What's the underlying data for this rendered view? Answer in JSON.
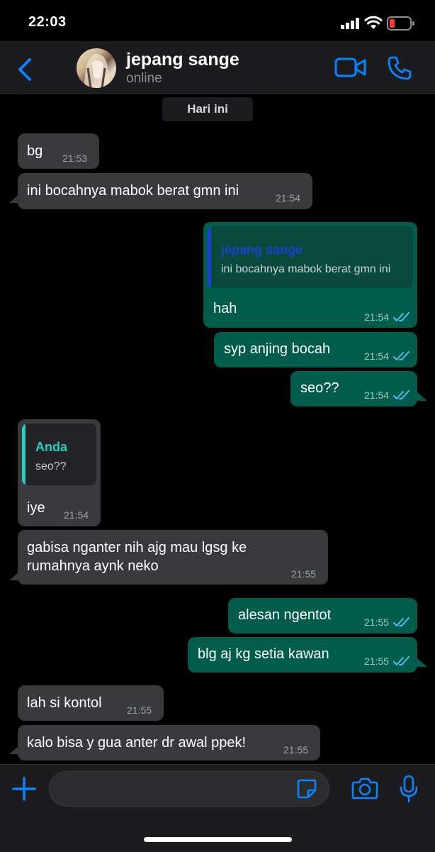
{
  "status_bar": {
    "time": "22:03",
    "battery_color": "#ff3b30"
  },
  "header": {
    "contact_name": "jepang sange",
    "contact_status": "online",
    "accent": "#0a84ff",
    "icons": [
      "chevron-left-icon",
      "video-call-icon",
      "phone-icon"
    ]
  },
  "date_separator": "Hari ini",
  "messages": [
    {
      "dir": "in",
      "text": "bg",
      "time": "21:53"
    },
    {
      "dir": "in",
      "text": "ini bocahnya mabok berat gmn ini",
      "time": "21:54"
    },
    {
      "dir": "out",
      "quote_author": "jepang sange",
      "quote_text": "ini bocahnya mabok berat gmn ini",
      "text": "hah",
      "time": "21:54",
      "read": true
    },
    {
      "dir": "out",
      "text": "syp anjing bocah",
      "time": "21:54",
      "read": true
    },
    {
      "dir": "out",
      "text": "seo??",
      "time": "21:54",
      "read": true
    },
    {
      "dir": "in",
      "quote_author": "Anda",
      "quote_text": "seo??",
      "text": "iye",
      "time": "21:54"
    },
    {
      "dir": "in",
      "text_lines": [
        "gabisa nganter nih ajg mau lgsg ke",
        "rumahnya aynk neko"
      ],
      "time": "21:55"
    },
    {
      "dir": "out",
      "text": "alesan ngentot",
      "time": "21:55",
      "read": true
    },
    {
      "dir": "out",
      "text": "blg aj kg setia kawan",
      "time": "21:55",
      "read": true
    },
    {
      "dir": "in",
      "text": "lah si kontol",
      "time": "21:55"
    },
    {
      "dir": "in",
      "text": "kalo bisa y gua anter dr awal ppek!",
      "time": "21:55"
    }
  ],
  "colors": {
    "incoming_bubble": "#3a3a3c",
    "outgoing_bubble": "#005c4b",
    "read_ticks": "#53bdeb",
    "quote_out_bar": "#1f3fd1",
    "quote_in_bar": "#25d0c0"
  },
  "input_bar": {
    "message_placeholder": "",
    "icons": [
      "plus-icon",
      "sticker-icon",
      "camera-icon",
      "microphone-icon"
    ]
  }
}
